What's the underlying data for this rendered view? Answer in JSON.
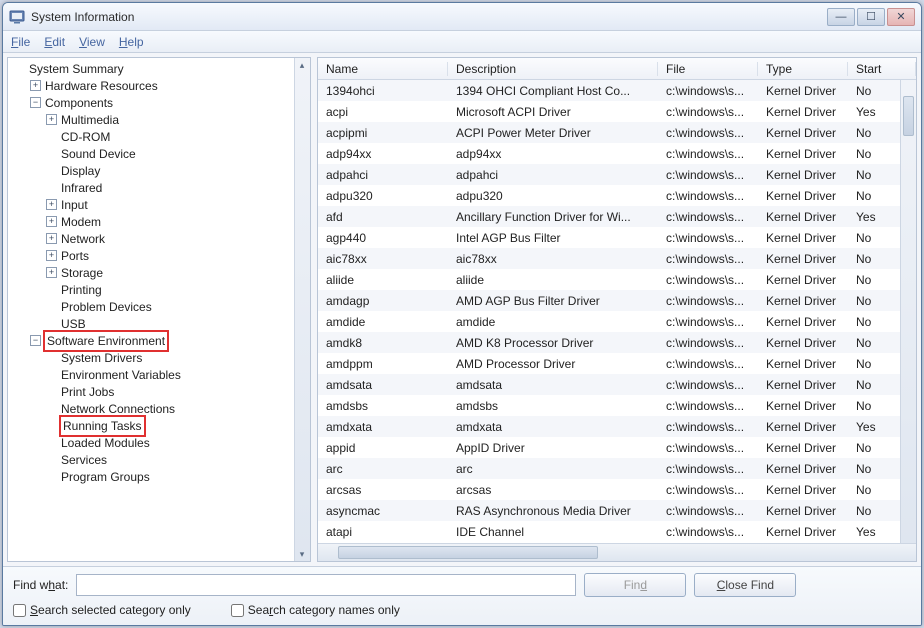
{
  "window": {
    "title": "System Information"
  },
  "menubar": {
    "file": "File",
    "edit": "Edit",
    "view": "View",
    "help": "Help"
  },
  "tree": {
    "root": "System Summary",
    "hardware": "Hardware Resources",
    "components": "Components",
    "comp_items": [
      "Multimedia",
      "CD-ROM",
      "Sound Device",
      "Display",
      "Infrared",
      "Input",
      "Modem",
      "Network",
      "Ports",
      "Storage",
      "Printing",
      "Problem Devices",
      "USB"
    ],
    "software_env": "Software Environment",
    "env_items": [
      "System Drivers",
      "Environment Variables",
      "Print Jobs",
      "Network Connections",
      "Running Tasks",
      "Loaded Modules",
      "Services",
      "Program Groups"
    ]
  },
  "columns": {
    "name": "Name",
    "desc": "Description",
    "file": "File",
    "type": "Type",
    "start": "Start"
  },
  "rows": [
    {
      "name": "1394ohci",
      "desc": "1394 OHCI Compliant Host Co...",
      "file": "c:\\windows\\s...",
      "type": "Kernel Driver",
      "start": "No"
    },
    {
      "name": "acpi",
      "desc": "Microsoft ACPI Driver",
      "file": "c:\\windows\\s...",
      "type": "Kernel Driver",
      "start": "Yes"
    },
    {
      "name": "acpipmi",
      "desc": "ACPI Power Meter Driver",
      "file": "c:\\windows\\s...",
      "type": "Kernel Driver",
      "start": "No"
    },
    {
      "name": "adp94xx",
      "desc": "adp94xx",
      "file": "c:\\windows\\s...",
      "type": "Kernel Driver",
      "start": "No"
    },
    {
      "name": "adpahci",
      "desc": "adpahci",
      "file": "c:\\windows\\s...",
      "type": "Kernel Driver",
      "start": "No"
    },
    {
      "name": "adpu320",
      "desc": "adpu320",
      "file": "c:\\windows\\s...",
      "type": "Kernel Driver",
      "start": "No"
    },
    {
      "name": "afd",
      "desc": "Ancillary Function Driver for Wi...",
      "file": "c:\\windows\\s...",
      "type": "Kernel Driver",
      "start": "Yes"
    },
    {
      "name": "agp440",
      "desc": "Intel AGP Bus Filter",
      "file": "c:\\windows\\s...",
      "type": "Kernel Driver",
      "start": "No"
    },
    {
      "name": "aic78xx",
      "desc": "aic78xx",
      "file": "c:\\windows\\s...",
      "type": "Kernel Driver",
      "start": "No"
    },
    {
      "name": "aliide",
      "desc": "aliide",
      "file": "c:\\windows\\s...",
      "type": "Kernel Driver",
      "start": "No"
    },
    {
      "name": "amdagp",
      "desc": "AMD AGP Bus Filter Driver",
      "file": "c:\\windows\\s...",
      "type": "Kernel Driver",
      "start": "No"
    },
    {
      "name": "amdide",
      "desc": "amdide",
      "file": "c:\\windows\\s...",
      "type": "Kernel Driver",
      "start": "No"
    },
    {
      "name": "amdk8",
      "desc": "AMD K8 Processor Driver",
      "file": "c:\\windows\\s...",
      "type": "Kernel Driver",
      "start": "No"
    },
    {
      "name": "amdppm",
      "desc": "AMD Processor Driver",
      "file": "c:\\windows\\s...",
      "type": "Kernel Driver",
      "start": "No"
    },
    {
      "name": "amdsata",
      "desc": "amdsata",
      "file": "c:\\windows\\s...",
      "type": "Kernel Driver",
      "start": "No"
    },
    {
      "name": "amdsbs",
      "desc": "amdsbs",
      "file": "c:\\windows\\s...",
      "type": "Kernel Driver",
      "start": "No"
    },
    {
      "name": "amdxata",
      "desc": "amdxata",
      "file": "c:\\windows\\s...",
      "type": "Kernel Driver",
      "start": "Yes"
    },
    {
      "name": "appid",
      "desc": "AppID Driver",
      "file": "c:\\windows\\s...",
      "type": "Kernel Driver",
      "start": "No"
    },
    {
      "name": "arc",
      "desc": "arc",
      "file": "c:\\windows\\s...",
      "type": "Kernel Driver",
      "start": "No"
    },
    {
      "name": "arcsas",
      "desc": "arcsas",
      "file": "c:\\windows\\s...",
      "type": "Kernel Driver",
      "start": "No"
    },
    {
      "name": "asyncmac",
      "desc": "RAS Asynchronous Media Driver",
      "file": "c:\\windows\\s...",
      "type": "Kernel Driver",
      "start": "No"
    },
    {
      "name": "atapi",
      "desc": "IDE Channel",
      "file": "c:\\windows\\s...",
      "type": "Kernel Driver",
      "start": "Yes"
    }
  ],
  "find": {
    "label": "Find what:",
    "value": "",
    "find_btn": "Find",
    "close_btn": "Close Find",
    "opt1": "Search selected category only",
    "opt2": "Search category names only"
  },
  "comp_expandable": {
    "0": true,
    "5": true,
    "6": true,
    "7": true,
    "8": true,
    "9": true
  },
  "highlights": {
    "software_env": true,
    "running_tasks_index": 4
  }
}
